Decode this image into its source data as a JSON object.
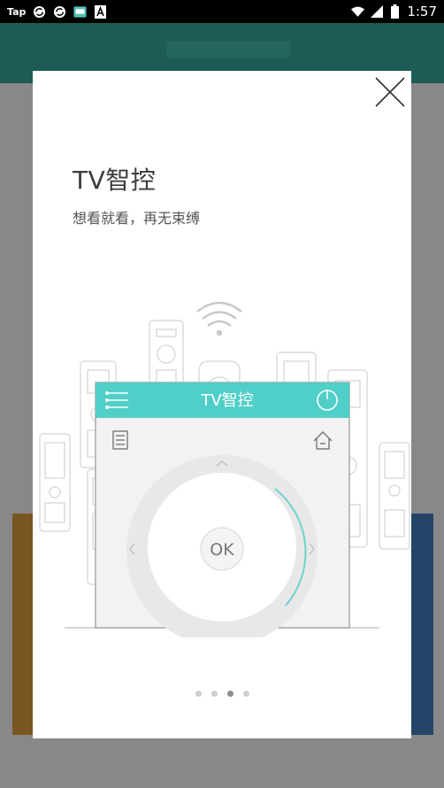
{
  "status_bar": {
    "app_label": "Tap",
    "icons": [
      "sync-icon",
      "sync-icon",
      "screen-icon",
      "text-a-icon",
      "wifi-icon",
      "signal-icon",
      "battery-icon"
    ],
    "time": "1:57"
  },
  "dialog": {
    "close_icon": "close-icon",
    "title": "TV智控",
    "subtitle": "想看就看，再无束缚",
    "illustration": {
      "remote_header_title": "TV智控",
      "ok_label": "OK",
      "icons": [
        "menu-icon",
        "power-icon",
        "list-icon",
        "home-icon",
        "chevron-up-icon",
        "chevron-left-icon",
        "chevron-right-icon",
        "wifi-icon"
      ]
    },
    "pager": {
      "total": 4,
      "active_index": 2
    }
  },
  "colors": {
    "accent": "#4fcfc7",
    "background_header": "#2f9488",
    "dialog_bg": "#ffffff",
    "dot_active": "#8d8d8d",
    "dot_inactive": "#cfcfcf"
  }
}
